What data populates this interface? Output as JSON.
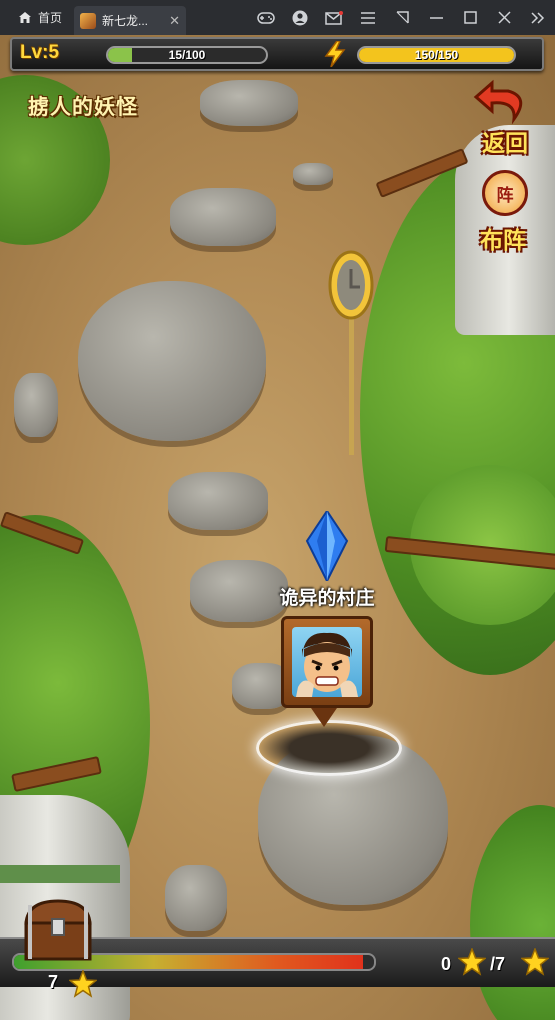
{
  "browser": {
    "home_tab_label": "首页",
    "game_tab_label": "新七龙...",
    "tab_close": "✕"
  },
  "hud": {
    "level_text": "Lv:5",
    "exp_text": "15/100",
    "exp_fraction": 0.15,
    "energy_text": "150/150",
    "energy_fraction": 1.0
  },
  "stage_title": "掳人的妖怪",
  "buttons": {
    "return_label": "返回",
    "formation_label": "布阵",
    "formation_emblem": "阵"
  },
  "map": {
    "node_label": "诡异的村庄"
  },
  "bottom": {
    "chest_star_count": "7",
    "earned_stars": "0",
    "total_stars": "/7",
    "progress_fraction": 0.97
  },
  "colors": {
    "exp_fill": "#8bc34a",
    "energy_fill": "#f3c41d",
    "text_gold": "#ffe35a"
  }
}
